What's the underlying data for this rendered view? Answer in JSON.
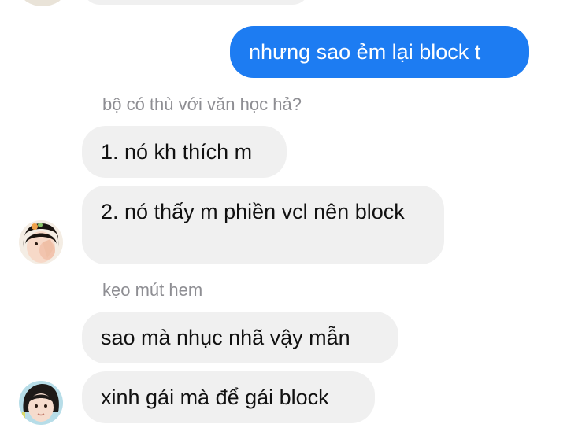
{
  "conversation": {
    "outgoing": [
      {
        "text": "nhưng sao ẻm lại block t"
      }
    ],
    "groups": [
      {
        "sender": "bộ có thù với văn học hả?",
        "messages": [
          "1. nó kh thích m",
          "2. nó thấy m phiền vcl nên block"
        ]
      },
      {
        "sender": "kẹo mút hem",
        "messages": [
          "sao mà nhục nhã vậy mẫn",
          "xinh gái mà để gái block"
        ]
      }
    ]
  },
  "colors": {
    "outgoing_bubble": "#1d7cf2",
    "incoming_bubble": "#f0f0f0",
    "sender_name": "#8e8e93"
  },
  "icons": {
    "avatar_1": "user-avatar-icon",
    "avatar_2": "user-avatar-icon"
  }
}
